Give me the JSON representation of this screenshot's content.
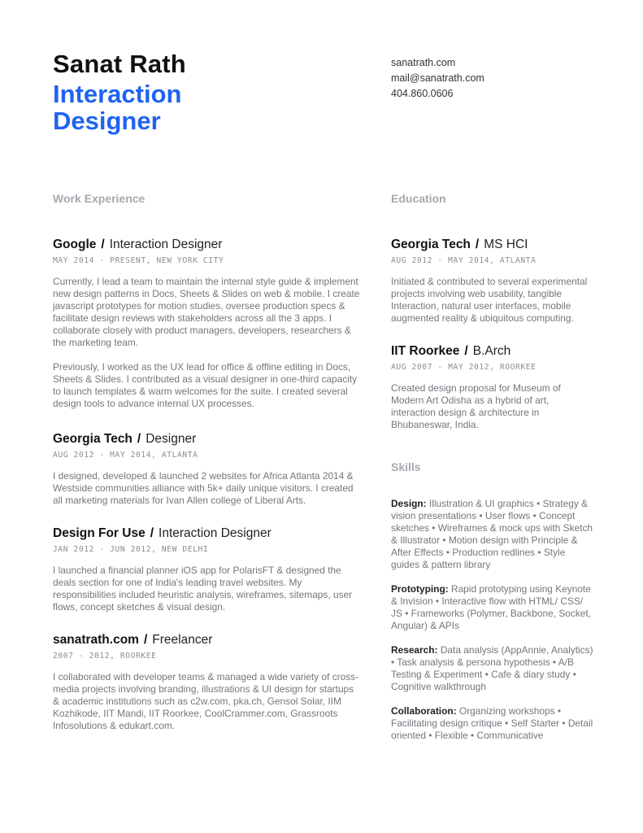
{
  "header": {
    "name": "Sanat Rath",
    "role": "Interaction Designer",
    "accent_color": "#1f63f0"
  },
  "contact": {
    "website": "sanatrath.com",
    "email": "mail@sanatrath.com",
    "phone": "404.860.0606"
  },
  "work": {
    "title": "Work Experience",
    "entries": [
      {
        "org": "Google",
        "position": "Interaction Designer",
        "meta": "MAY 2014 - PRESENT, NEW YORK CITY",
        "paragraphs": [
          "Currently, I lead a team to maintain the internal style guide & implement new design patterns in Docs, Sheets & Slides on web & mobile. I create javascript prototypes for motion studies, oversee production specs & facilitate design reviews with stakeholders across all the 3 apps. I collaborate closely with product managers, developers, researchers & the marketing team.",
          "Previously, I worked as the UX lead for office & offline editing in Docs, Sheets & Slides. I contributed as a visual designer in one-third capacity to launch templates & warm welcomes for the suite. I created several design tools to advance internal UX processes."
        ]
      },
      {
        "org": "Georgia Tech",
        "position": "Designer",
        "meta": "AUG 2012 - MAY 2014, ATLANTA",
        "paragraphs": [
          "I designed, developed & launched 2 websites for Africa Atlanta 2014 & Westside communities alliance with 5k+ daily unique visitors. I created all marketing materials for Ivan Allen college of Liberal Arts."
        ]
      },
      {
        "org": "Design For Use",
        "position": "Interaction Designer",
        "meta": "JAN 2012 - JUN 2012, NEW DELHI",
        "paragraphs": [
          "I launched a financial planner iOS app for PolarisFT & designed the deals section for one of India's leading travel websites. My responsibilities included heuristic analysis, wireframes, sitemaps, user flows, concept sketches & visual design."
        ]
      },
      {
        "org": "sanatrath.com",
        "position": "Freelancer",
        "meta": "2007 - 2012, ROORKEE",
        "paragraphs": [
          "I collaborated with developer teams & managed a wide variety of cross-media projects involving branding, illustrations & UI design for startups & academic institutions such as c2w.com, pka.ch, Gensol Solar, IIM Kozhikode, IIT Mandi, IIT Roorkee, CoolCrammer.com, Grassroots Infosolutions & edukart.com."
        ]
      }
    ]
  },
  "education": {
    "title": "Education",
    "entries": [
      {
        "org": "Georgia Tech",
        "position": "MS HCI",
        "meta": "AUG 2012 - MAY 2014, ATLANTA",
        "paragraphs": [
          "Initiated & contributed to several experimental projects involving web usability, tangible Interaction, natural user interfaces, mobile augmented reality & ubiquitous computing."
        ]
      },
      {
        "org": "IIT Roorkee",
        "position": "B.Arch",
        "meta": "AUG 2007 - MAY 2012, ROORKEE",
        "paragraphs": [
          "Created design proposal for Museum of Modern Art Odisha as a hybrid of art, interaction design & architecture in Bhubaneswar, India."
        ]
      }
    ]
  },
  "skills": {
    "title": "Skills",
    "groups": [
      {
        "label": "Design:",
        "text": "Illustration & UI graphics • Strategy & vision presentations • User flows • Concept sketches • Wireframes & mock ups with Sketch & Illustrator • Motion design with Principle & After Effects • Production redlines • Style guides & pattern library"
      },
      {
        "label": "Prototyping:",
        "text": "Rapid prototyping using Keynote & Invision • Interactive flow with HTML/ CSS/ JS • Frameworks (Polymer, Backbone, Socket, Angular) & APIs"
      },
      {
        "label": "Research:",
        "text": "Data analysis (AppAnnie, Analytics) • Task analysis & persona hypothesis • A/B Testing & Experiment • Cafe & diary study • Cognitive walkthrough"
      },
      {
        "label": "Collaboration:",
        "text": "Organizing workshops • Facilitating design critique • Self Starter • Detail oriented • Flexible • Communicative"
      }
    ]
  }
}
